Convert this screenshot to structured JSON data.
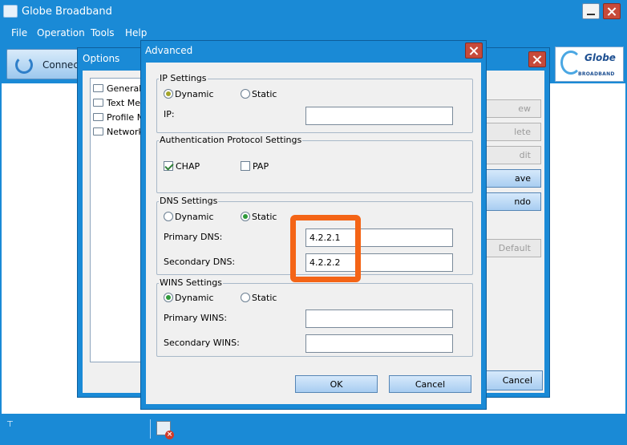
{
  "main_window": {
    "title": "Globe Broadband",
    "menu": [
      "File",
      "Operation",
      "Tools",
      "Help"
    ],
    "toolbar": {
      "connect_label": "Connecti"
    },
    "logo": {
      "brand": "Globe",
      "tagline": "BROADBAND"
    },
    "status_left": "⊤"
  },
  "options_dialog": {
    "title": "Options",
    "tree_items": [
      "General",
      "Text Mes",
      "Profile M",
      "Network"
    ],
    "buttons": [
      "ew",
      "lete",
      "dit",
      "ave",
      "ndo",
      "Default",
      "Cancel"
    ]
  },
  "advanced_dialog": {
    "title": "Advanced",
    "ip_settings": {
      "legend": "IP Settings",
      "dynamic": "Dynamic",
      "static": "Static",
      "selected": "Dynamic",
      "ip_label": "IP:",
      "ip_value": ""
    },
    "auth_settings": {
      "legend": "Authentication Protocol Settings",
      "chap": "CHAP",
      "chap_checked": true,
      "pap": "PAP",
      "pap_checked": false
    },
    "dns_settings": {
      "legend": "DNS Settings",
      "dynamic": "Dynamic",
      "static": "Static",
      "selected": "Static",
      "primary_label": "Primary DNS:",
      "primary_value": "4.2.2.1",
      "secondary_label": "Secondary DNS:",
      "secondary_value": "4.2.2.2"
    },
    "wins_settings": {
      "legend": "WINS Settings",
      "dynamic": "Dynamic",
      "static": "Static",
      "selected": "Dynamic",
      "primary_label": "Primary WINS:",
      "primary_value": "",
      "secondary_label": "Secondary WINS:",
      "secondary_value": ""
    },
    "ok_label": "OK",
    "cancel_label": "Cancel"
  },
  "colors": {
    "window_blue": "#1a8ad6",
    "highlight_orange": "#f46416",
    "close_red": "#c74a3a"
  }
}
